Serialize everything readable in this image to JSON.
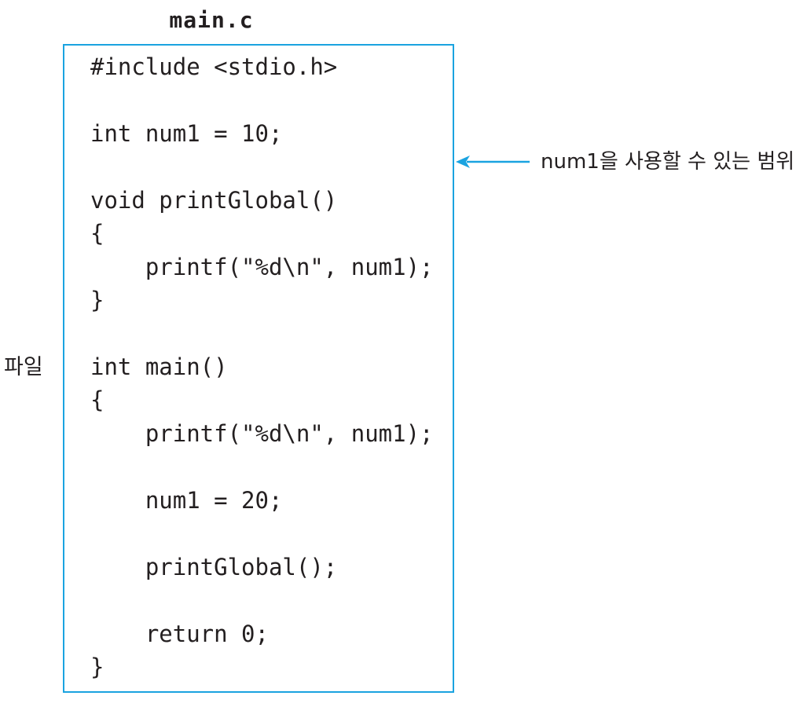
{
  "file_name": "main.c",
  "side_label": "파일",
  "scope_label": "num1을 사용할 수 있는 범위",
  "colors": {
    "box_border": "#1aa3e0",
    "arrow": "#1aa3e0",
    "text": "#231f20"
  },
  "code_lines": [
    "#include <stdio.h>",
    "int num1 = 10;",
    "void printGlobal()",
    "{",
    "    printf(\"%d\\n\", num1);",
    "}",
    "int main()",
    "{",
    "    printf(\"%d\\n\", num1);",
    "    num1 = 20;",
    "    printGlobal();",
    "    return 0;",
    "}"
  ]
}
